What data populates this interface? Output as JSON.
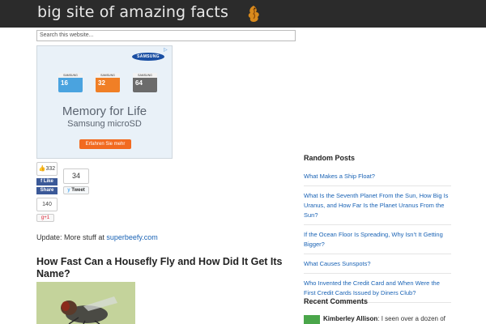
{
  "site": {
    "title": "big site of amazing facts"
  },
  "search": {
    "placeholder": "Search this website..."
  },
  "ad": {
    "brand": "SAMSUNG",
    "cards": [
      {
        "label": "SAMSUNG",
        "capacity": "16",
        "color": "#4aa3df"
      },
      {
        "label": "SAMSUNG",
        "capacity": "32",
        "color": "#f07f26"
      },
      {
        "label": "SAMSUNG",
        "capacity": "64",
        "color": "#6b6b6b"
      }
    ],
    "headline": "Memory for Life",
    "subline": "Samsung microSD",
    "cta": "Erfahren Sie mehr"
  },
  "share": {
    "facebook_count": "332",
    "like_label": "Like",
    "share_label": "Share",
    "share_count": "140",
    "gplus_label": "g+1",
    "tweet_count": "34",
    "tweet_label": "Tweet"
  },
  "update": {
    "prefix": "Update: More stuff at ",
    "link_text": "superbeefy.com"
  },
  "post": {
    "title": "How Fast Can a Housefly Fly and How Did It Get Its Name?"
  },
  "sidebar": {
    "random_heading": "Random Posts",
    "random_posts": [
      "What Makes a Ship Float?",
      "What Is the Seventh Planet From the Sun, How Big Is Uranus, and How Far Is the Planet Uranus From the Sun?",
      "If the Ocean Floor Is Spreading, Why Isn’t It Getting Bigger?",
      "What Causes Sunspots?",
      "Who Invented the Credit Card and When Were the First Credit Cards Issued by Diners Club?"
    ],
    "comments_heading": "Recent Comments",
    "comment_author": "Kimberley Allison",
    "comment_text": ": I seen over a dozen of"
  },
  "colors": {
    "topbar": "#2b2b2b",
    "link": "#1a63b5",
    "facebook": "#3b5998",
    "ad_cta": "#f26a20"
  }
}
